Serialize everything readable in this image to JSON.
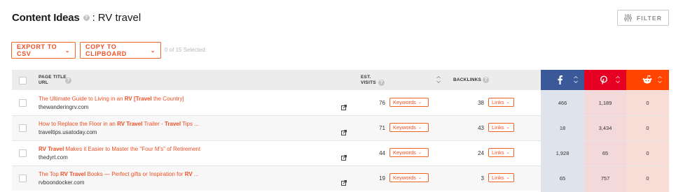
{
  "header": {
    "title": "Content Ideas",
    "help_glyph": "?",
    "separator": ":",
    "query": "RV travel",
    "filter_label": "FILTER",
    "filter_icon": "sliders-icon"
  },
  "actions": {
    "export_label": "EXPORT TO CSV",
    "copy_label": "COPY TO CLIPBOARD",
    "selected_text": "0 of 15 Selected"
  },
  "table": {
    "columns": {
      "page_title": "PAGE TITLE",
      "url": "URL",
      "est": "EST.",
      "visits": "VISITS",
      "backlinks": "BACKLINKS",
      "facebook_icon": "facebook-icon",
      "pinterest_icon": "pinterest-icon",
      "reddit_icon": "reddit-icon"
    },
    "colors": {
      "facebook": "#3b5998",
      "pinterest": "#e60023",
      "reddit": "#ff4500",
      "accent": "#f04e23",
      "fb_cell": "#dfe4ec",
      "pi_cell": "#f3d9da",
      "rd_cell": "#f8dcd6"
    },
    "rows": [
      {
        "title_parts": [
          "The Ultimate Guide to Living in an ",
          "RV",
          " ",
          "[Travel",
          " the Country]"
        ],
        "url": "thewanderingrv.com",
        "visits": "76",
        "keywords_label": "Keywords",
        "backlinks": "38",
        "links_label": "Links",
        "facebook": "466",
        "pinterest": "1,189",
        "reddit": "0"
      },
      {
        "title_parts": [
          "How to Replace the Floor in an ",
          "RV Travel",
          " Trailer - ",
          "Travel",
          " Tips ..."
        ],
        "url": "traveltips.usatoday.com",
        "visits": "71",
        "keywords_label": "Keywords",
        "backlinks": "43",
        "links_label": "Links",
        "facebook": "18",
        "pinterest": "3,434",
        "reddit": "0"
      },
      {
        "title_parts": [
          "",
          "RV Travel",
          " Makes it Easier to Master the \"Four M's\" of Retirement",
          "",
          ""
        ],
        "url": "thedyrt.com",
        "visits": "44",
        "keywords_label": "Keywords",
        "backlinks": "24",
        "links_label": "Links",
        "facebook": "1,928",
        "pinterest": "65",
        "reddit": "0"
      },
      {
        "title_parts": [
          "The Top ",
          "RV Travel",
          " Books — Perfect gifts or Inspiration for ",
          "RV",
          " ..."
        ],
        "url": "rvboondocker.com",
        "visits": "19",
        "keywords_label": "Keywords",
        "backlinks": "3",
        "links_label": "Links",
        "facebook": "65",
        "pinterest": "757",
        "reddit": "0"
      }
    ]
  }
}
